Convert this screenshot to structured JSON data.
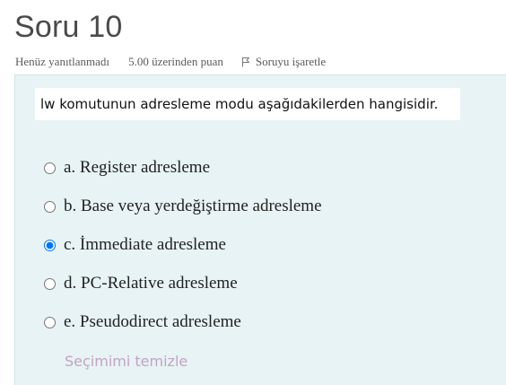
{
  "question": {
    "title": "Soru 10",
    "state": "Henüz yanıtlanmadı",
    "grade": "5.00 üzerinden puan",
    "flag_label": "Soruyu işaretle",
    "text": "lw komutunun adresleme modu aşağıdakilerden hangisidir."
  },
  "answers": [
    {
      "label": "a. Register adresleme",
      "selected": false
    },
    {
      "label": "b. Base veya yerdeğiştirme adresleme",
      "selected": false
    },
    {
      "label": "c. İmmediate adresleme",
      "selected": true
    },
    {
      "label": "d. PC-Relative adresleme",
      "selected": false
    },
    {
      "label": "e. Pseudodirect adresleme",
      "selected": false
    }
  ],
  "clear_choice_label": "Seçimimi temizle",
  "colors": {
    "formulation_background": "#e7f3f5",
    "clear_link": "#c4a3c1"
  },
  "icons": {
    "flag": "flag-outline-icon"
  }
}
